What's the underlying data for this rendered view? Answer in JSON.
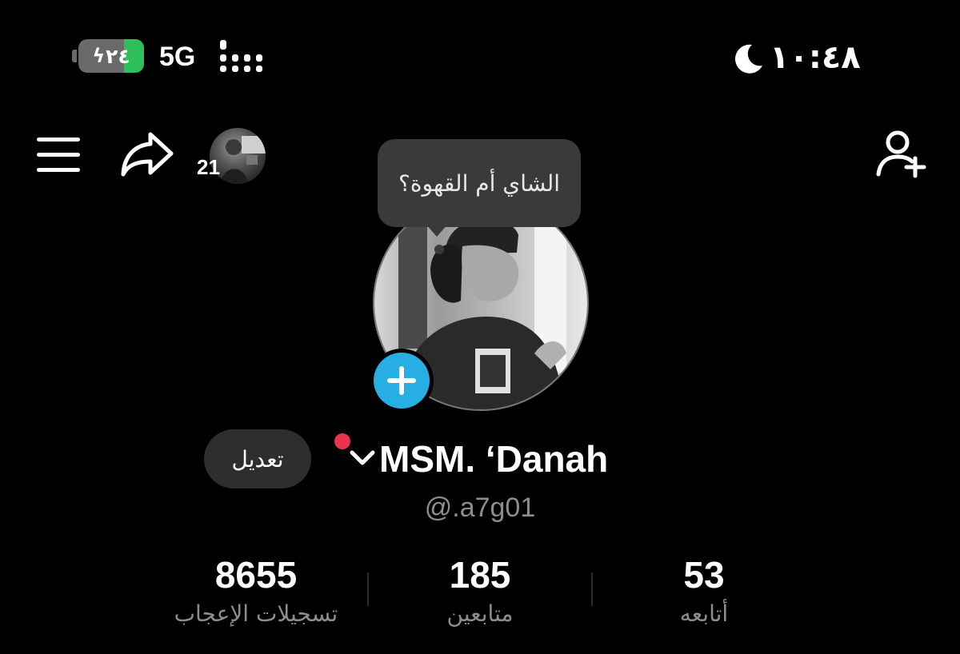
{
  "status_bar": {
    "battery_text": "٢٤",
    "battery_level": 0.3,
    "network": "5G",
    "time": "١٠:٤٨",
    "icons": [
      "battery-charging-icon",
      "signal-bars-icon",
      "moon-icon"
    ]
  },
  "toolbar": {
    "story_count": "21",
    "icons": [
      "menu-icon",
      "share-icon",
      "add-friend-icon"
    ]
  },
  "tooltip": {
    "text": "الشاي أم القهوة؟"
  },
  "profile": {
    "display_name": "MSM. ‘Danah",
    "username": "@.a7g01",
    "edit_label": "تعديل",
    "accent_color": "#27aee2",
    "notification_color": "#e8344e"
  },
  "stats": [
    {
      "value": "8655",
      "label": "تسجيلات الإعجاب"
    },
    {
      "value": "185",
      "label": "متابعين"
    },
    {
      "value": "53",
      "label": "أتابعه"
    }
  ]
}
